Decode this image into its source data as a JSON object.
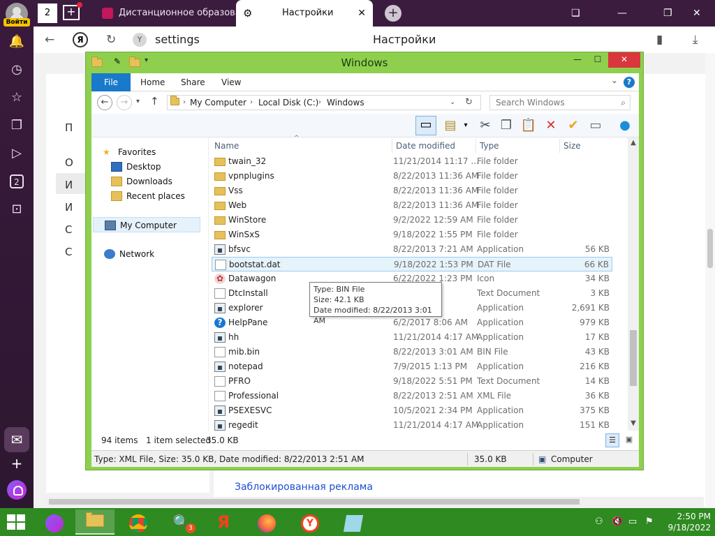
{
  "browser": {
    "login_label": "Войти",
    "tabs": [
      {
        "title": "Дистанционное образова"
      },
      {
        "title": "Настройки"
      }
    ],
    "home_badge": "2",
    "address": "settings",
    "page_title": "Настройки",
    "y_logo": "Я",
    "side_badge": "2",
    "page_letters": [
      "П",
      "О",
      "И",
      "И",
      "С",
      "С"
    ],
    "page_link": "Заблокированная реклама"
  },
  "explorer": {
    "title": "Windows",
    "ribbon_tabs": [
      "File",
      "Home",
      "Share",
      "View"
    ],
    "breadcrumb": [
      "My Computer",
      "Local Disk (C:)",
      "Windows"
    ],
    "search_placeholder": "Search Windows",
    "nav": {
      "favorites": "Favorites",
      "favorites_items": [
        "Desktop",
        "Downloads",
        "Recent places"
      ],
      "computer": "My Computer",
      "network": "Network"
    },
    "columns": {
      "name": "Name",
      "date": "Date modified",
      "type": "Type",
      "size": "Size"
    },
    "files": [
      {
        "name": "twain_32",
        "date": "11/21/2014 11:17 ...",
        "type": "File folder",
        "size": "",
        "icon": "folder"
      },
      {
        "name": "vpnplugins",
        "date": "8/22/2013 11:36 AM",
        "type": "File folder",
        "size": "",
        "icon": "folder"
      },
      {
        "name": "Vss",
        "date": "8/22/2013 11:36 AM",
        "type": "File folder",
        "size": "",
        "icon": "folder"
      },
      {
        "name": "Web",
        "date": "8/22/2013 11:36 AM",
        "type": "File folder",
        "size": "",
        "icon": "folder"
      },
      {
        "name": "WinStore",
        "date": "9/2/2022 12:59 AM",
        "type": "File folder",
        "size": "",
        "icon": "folder"
      },
      {
        "name": "WinSxS",
        "date": "9/18/2022 1:55 PM",
        "type": "File folder",
        "size": "",
        "icon": "folder"
      },
      {
        "name": "bfsvc",
        "date": "8/22/2013 7:21 AM",
        "type": "Application",
        "size": "56 KB",
        "icon": "app"
      },
      {
        "name": "bootstat.dat",
        "date": "9/18/2022 1:53 PM",
        "type": "DAT File",
        "size": "66 KB",
        "icon": "doc"
      },
      {
        "name": "Datawagon",
        "date": "6/22/2022 1:23 PM",
        "type": "Icon",
        "size": "34 KB",
        "icon": "img"
      },
      {
        "name": "DtcInstall",
        "date": "...36 PM",
        "type": "Text Document",
        "size": "3 KB",
        "icon": "doc"
      },
      {
        "name": "explorer",
        "date": "...44 PM",
        "type": "Application",
        "size": "2,691 KB",
        "icon": "app"
      },
      {
        "name": "HelpPane",
        "date": "6/2/2017 8:06 AM",
        "type": "Application",
        "size": "979 KB",
        "icon": "help"
      },
      {
        "name": "hh",
        "date": "11/21/2014 4:17 AM",
        "type": "Application",
        "size": "17 KB",
        "icon": "app"
      },
      {
        "name": "mib.bin",
        "date": "8/22/2013 3:01 AM",
        "type": "BIN File",
        "size": "43 KB",
        "icon": "doc"
      },
      {
        "name": "notepad",
        "date": "7/9/2015 1:13 PM",
        "type": "Application",
        "size": "216 KB",
        "icon": "app"
      },
      {
        "name": "PFRO",
        "date": "9/18/2022 5:51 PM",
        "type": "Text Document",
        "size": "14 KB",
        "icon": "doc"
      },
      {
        "name": "Professional",
        "date": "8/22/2013 2:51 AM",
        "type": "XML File",
        "size": "36 KB",
        "icon": "doc"
      },
      {
        "name": "PSEXESVC",
        "date": "10/5/2021 2:34 PM",
        "type": "Application",
        "size": "375 KB",
        "icon": "app"
      },
      {
        "name": "regedit",
        "date": "11/21/2014 4:17 AM",
        "type": "Application",
        "size": "151 KB",
        "icon": "app"
      }
    ],
    "selected_index": 7,
    "tooltip": {
      "type": "Type: BIN File",
      "size": "Size: 42.1 KB",
      "date": "Date modified: 8/22/2013 3:01 AM"
    },
    "info": {
      "count": "94 items",
      "selected": "1 item selected",
      "sel_size": "35.0 KB"
    },
    "status": {
      "details": "Type: XML File, Size: 35.0 KB, Date modified: 8/22/2013 2:51 AM",
      "size": "35.0 KB",
      "location": "Computer"
    }
  },
  "taskbar": {
    "badge": "3",
    "yandex_letter": "Я",
    "time": "2:50 PM",
    "date": "9/18/2022"
  },
  "colors": {
    "window_frame": "#8ed04e",
    "taskbar": "#2f8a21",
    "browser_dark": "#3b1c3f",
    "accent_blue": "#1979ca"
  }
}
